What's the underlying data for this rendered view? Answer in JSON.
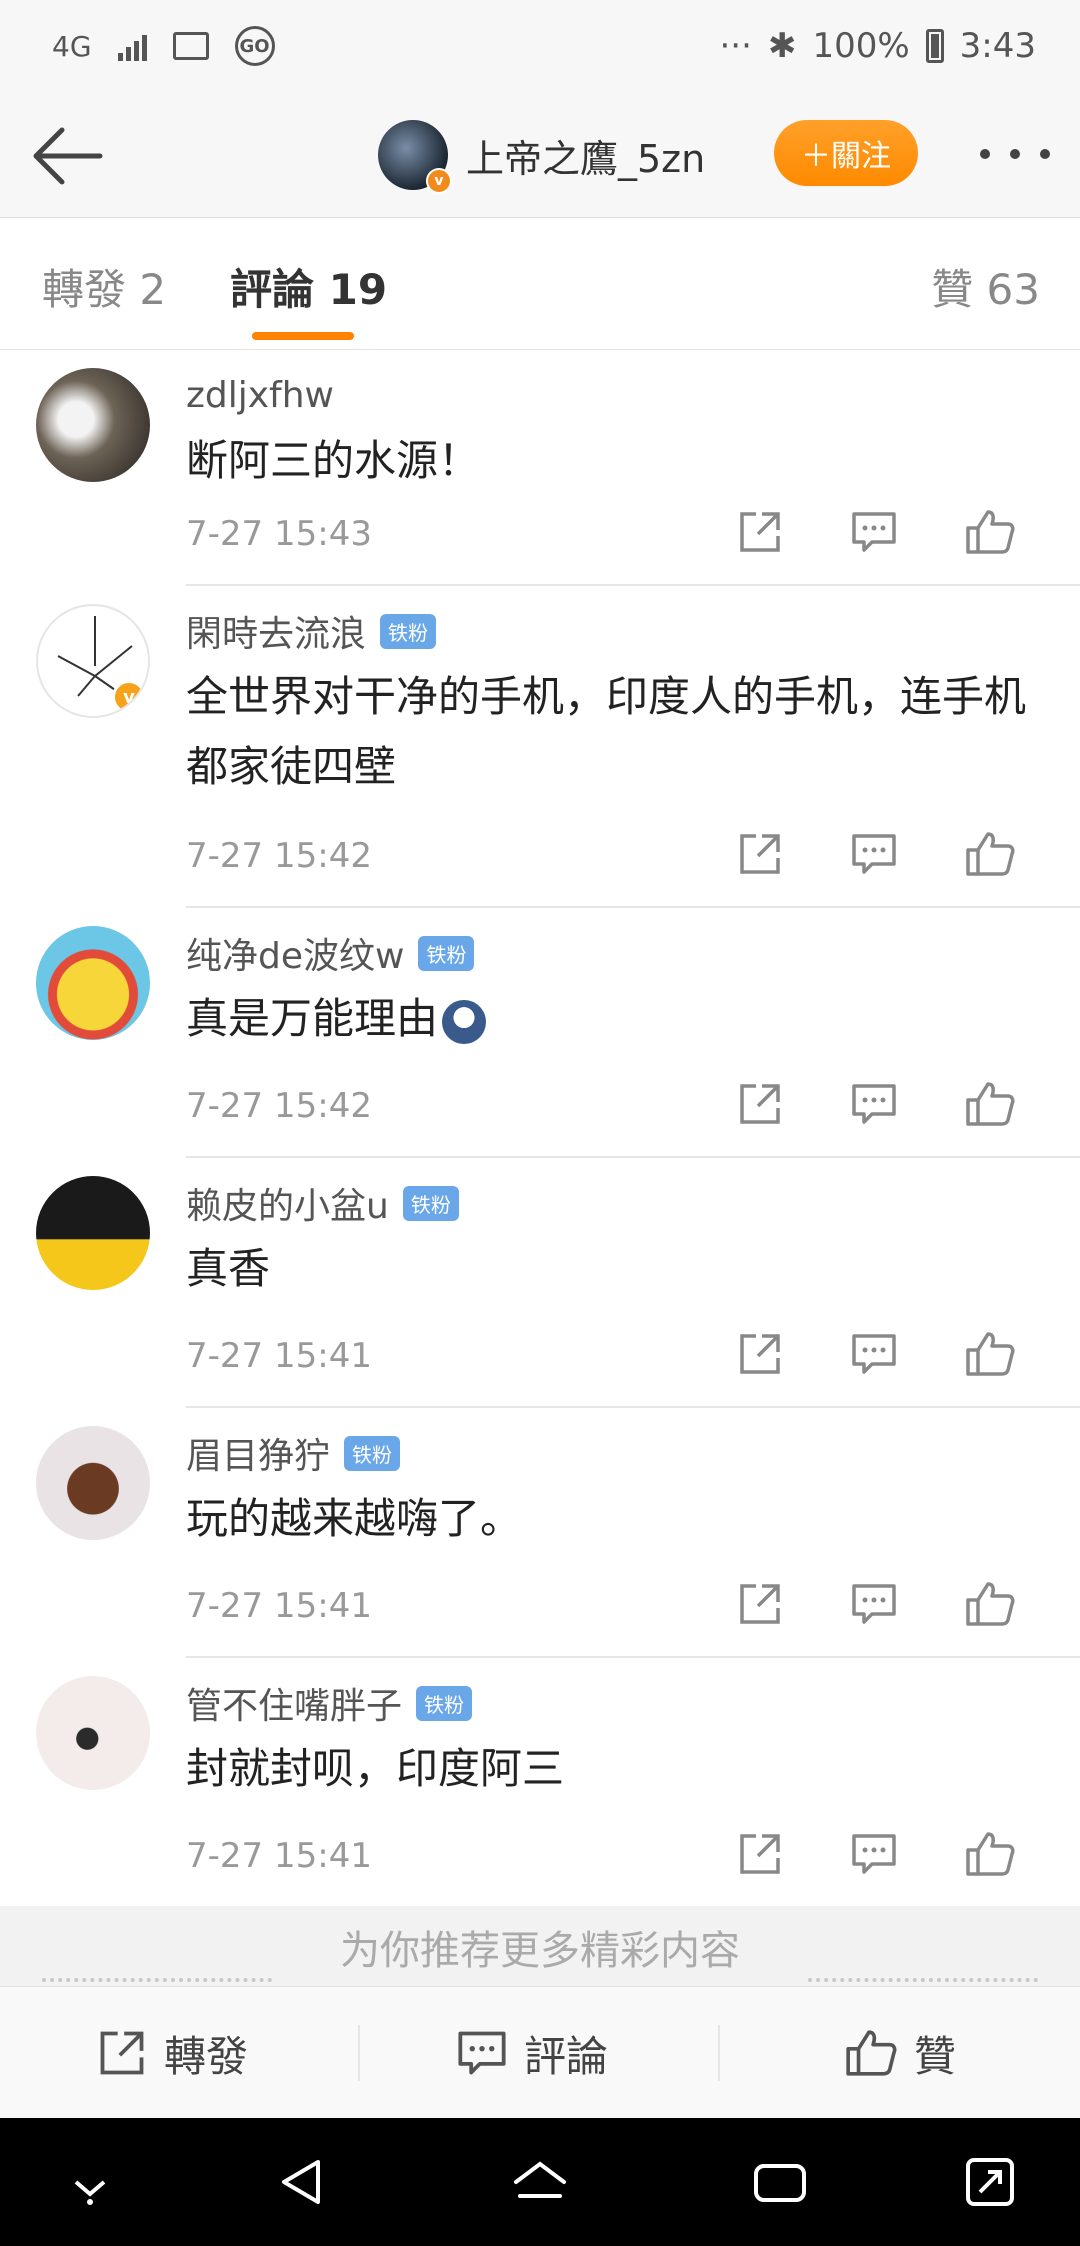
{
  "status_bar": {
    "network": "4G",
    "dots": "···",
    "battery": "100%",
    "time": "3:43",
    "icons": [
      "signal-icon",
      "image-icon",
      "go-icon",
      "bluetooth-icon",
      "battery-icon"
    ]
  },
  "header": {
    "username": "上帝之鷹_5zn",
    "verified_badge": "v",
    "follow_label": "＋關注"
  },
  "tabs": {
    "repost": "轉發 2",
    "comment": "評論 19",
    "like": "贊 63",
    "active": "comment",
    "accent_color": "#ff8200"
  },
  "comments": [
    {
      "name": "zdljxfhw",
      "fan_badge": "",
      "text": "断阿三的水源！",
      "time": "7-27 15:43"
    },
    {
      "name": "閑時去流浪",
      "fan_badge": "铁粉",
      "text": "全世界对干净的手机，印度人的手机，连手机都家徒四壁",
      "time": "7-27 15:42",
      "verified": "v"
    },
    {
      "name": "纯净de波纹w",
      "fan_badge": "铁粉",
      "text": "真是万能理由",
      "time": "7-27 15:42"
    },
    {
      "name": "赖皮的小盆u",
      "fan_badge": "铁粉",
      "text": "真香",
      "time": "7-27 15:41"
    },
    {
      "name": "眉目狰狞",
      "fan_badge": "铁粉",
      "text": "玩的越来越嗨了。",
      "time": "7-27 15:41"
    },
    {
      "name": "管不住嘴胖子",
      "fan_badge": "铁粉",
      "text": "封就封呗，印度阿三",
      "time": "7-27 15:41"
    }
  ],
  "recommend": {
    "text": "为你推荐更多精彩内容"
  },
  "bottom_bar": {
    "repost": "轉發",
    "comment": "評論",
    "like": "贊"
  }
}
